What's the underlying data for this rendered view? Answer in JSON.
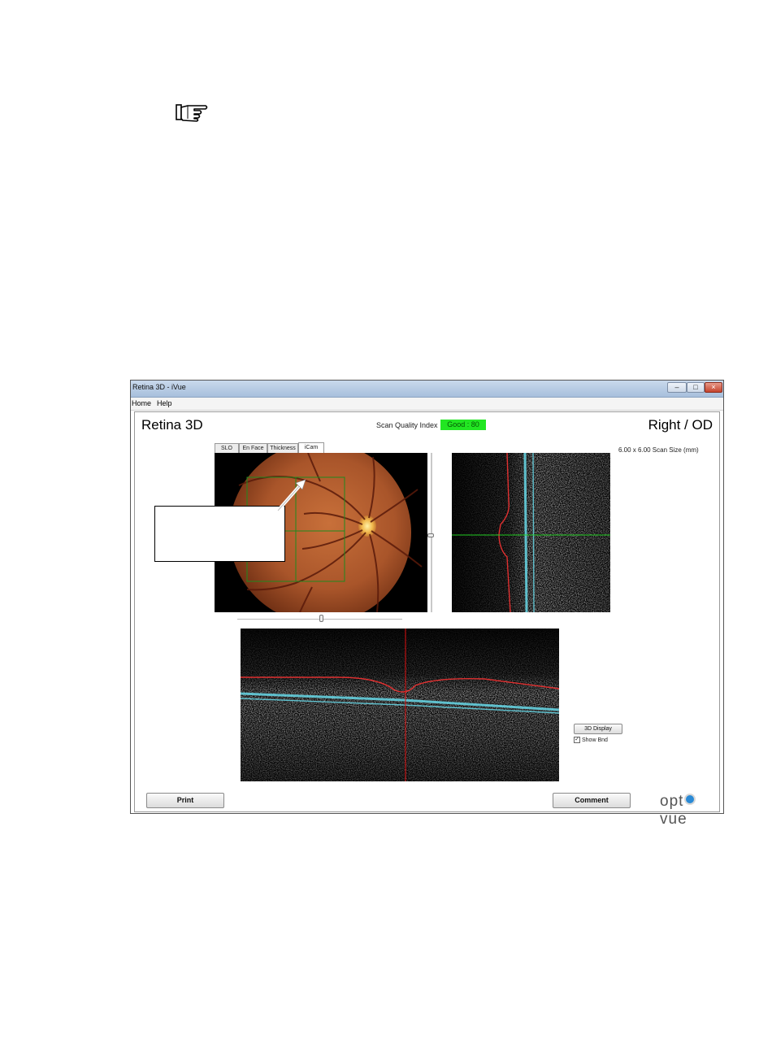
{
  "window": {
    "title": "Retina 3D - iVue",
    "controls": {
      "minimize": "–",
      "maximize": "□",
      "close": "×"
    }
  },
  "menu": {
    "home": "Home",
    "help": "Help"
  },
  "header": {
    "title": "Retina 3D",
    "eye": "Right / OD",
    "scan_quality_label": "Scan Quality Index",
    "scan_quality_value": "Good : 80",
    "scan_size": "6.00 x 6.00 Scan Size (mm)"
  },
  "tabs": [
    {
      "label": "SLO"
    },
    {
      "label": "En Face"
    },
    {
      "label": "Thickness"
    },
    {
      "label": "iCam",
      "active": true
    }
  ],
  "controls": {
    "display_3d": "3D Display",
    "show_bnd": "Show Bnd",
    "show_bnd_checked": "✓",
    "print": "Print",
    "comment": "Comment"
  },
  "logo": {
    "left": "opt",
    "right": "vue"
  },
  "colors": {
    "quality_good": "#22e622",
    "crosshair_green": "#22cc22",
    "boundary_red": "#e03030",
    "boundary_cyan": "#66d8e8",
    "logo_dot": "#2a8ad6"
  }
}
